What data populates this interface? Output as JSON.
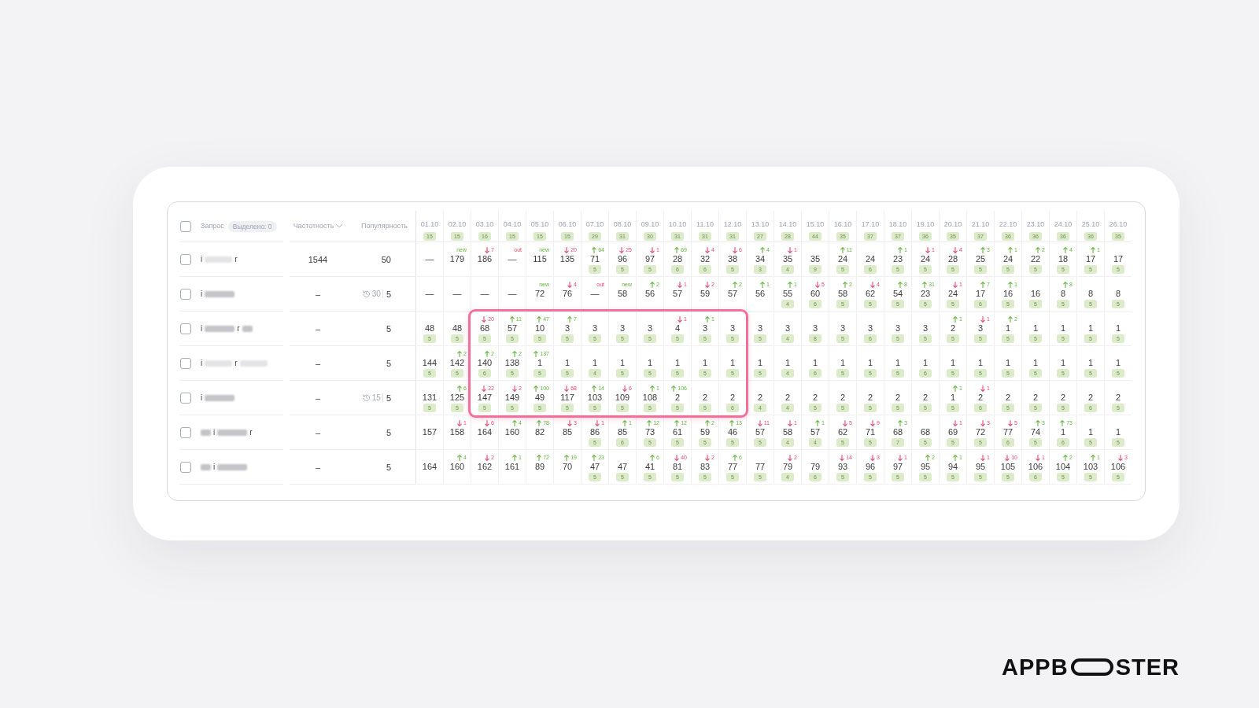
{
  "header": {
    "checked": false,
    "query_label": "Запрос",
    "selected_chip": "Выделено: 0",
    "frequency_label": "Частотность",
    "popularity_label": "Популярность"
  },
  "dates": [
    {
      "label": "01.10",
      "count": "15"
    },
    {
      "label": "02.10",
      "count": "15"
    },
    {
      "label": "03.10",
      "count": "16"
    },
    {
      "label": "04.10",
      "count": "15"
    },
    {
      "label": "05.10",
      "count": "15"
    },
    {
      "label": "06.10",
      "count": "15"
    },
    {
      "label": "07.10",
      "count": "29"
    },
    {
      "label": "08.10",
      "count": "31"
    },
    {
      "label": "09.10",
      "count": "30"
    },
    {
      "label": "10.10",
      "count": "31"
    },
    {
      "label": "11.10",
      "count": "31"
    },
    {
      "label": "12.10",
      "count": "31"
    },
    {
      "label": "13.10",
      "count": "27"
    },
    {
      "label": "14.10",
      "count": "28"
    },
    {
      "label": "15.10",
      "count": "44"
    },
    {
      "label": "16.10",
      "count": "35"
    },
    {
      "label": "17.10",
      "count": "37"
    },
    {
      "label": "18.10",
      "count": "37"
    },
    {
      "label": "19.10",
      "count": "36"
    },
    {
      "label": "20.10",
      "count": "35"
    },
    {
      "label": "21.10",
      "count": "37"
    },
    {
      "label": "22.10",
      "count": "36"
    },
    {
      "label": "23.10",
      "count": "36"
    },
    {
      "label": "24.10",
      "count": "36"
    },
    {
      "label": "25.10",
      "count": "36"
    },
    {
      "label": "26.10",
      "count": "35"
    }
  ],
  "rows": [
    {
      "checked": false,
      "query": [
        {
          "kind": "text",
          "text": "i"
        },
        {
          "kind": "faint_blur"
        },
        {
          "kind": "text",
          "text": "r"
        }
      ],
      "frequency": "1544",
      "popularity": "50",
      "cells": [
        {
          "kind": "same",
          "rank": "—"
        },
        {
          "kind": "new",
          "delta": "new",
          "rank": "179"
        },
        {
          "kind": "down",
          "delta": "7",
          "rank": "186"
        },
        {
          "kind": "out",
          "delta": "out",
          "rank": "—"
        },
        {
          "kind": "new",
          "delta": "new",
          "rank": "115"
        },
        {
          "kind": "down",
          "delta": "20",
          "rank": "135"
        },
        {
          "kind": "up",
          "delta": "64",
          "rank": "71",
          "badge": "5"
        },
        {
          "kind": "down",
          "delta": "25",
          "rank": "96",
          "badge": "5"
        },
        {
          "kind": "down",
          "delta": "1",
          "rank": "97",
          "badge": "5"
        },
        {
          "kind": "up",
          "delta": "69",
          "rank": "28",
          "badge": "6"
        },
        {
          "kind": "down",
          "delta": "4",
          "rank": "32",
          "badge": "6"
        },
        {
          "kind": "down",
          "delta": "6",
          "rank": "38",
          "badge": "5"
        },
        {
          "kind": "up",
          "delta": "4",
          "rank": "34",
          "badge": "3"
        },
        {
          "kind": "down",
          "delta": "1",
          "rank": "35",
          "badge": "4"
        },
        {
          "kind": "same",
          "rank": "35",
          "badge": "9"
        },
        {
          "kind": "up",
          "delta": "11",
          "rank": "24",
          "badge": "5"
        },
        {
          "kind": "same",
          "rank": "24",
          "badge": "6"
        },
        {
          "kind": "up",
          "delta": "1",
          "rank": "23",
          "badge": "5"
        },
        {
          "kind": "down",
          "delta": "1",
          "rank": "24",
          "badge": "5"
        },
        {
          "kind": "down",
          "delta": "4",
          "rank": "28",
          "badge": "5"
        },
        {
          "kind": "up",
          "delta": "3",
          "rank": "25",
          "badge": "5"
        },
        {
          "kind": "up",
          "delta": "1",
          "rank": "24",
          "badge": "5"
        },
        {
          "kind": "up",
          "delta": "2",
          "rank": "22",
          "badge": "5"
        },
        {
          "kind": "up",
          "delta": "4",
          "rank": "18",
          "badge": "5"
        },
        {
          "kind": "up",
          "delta": "1",
          "rank": "17",
          "badge": "5"
        },
        {
          "kind": "same",
          "rank": "17",
          "badge": "5"
        }
      ]
    },
    {
      "checked": false,
      "query": [
        {
          "kind": "text",
          "text": "i"
        },
        {
          "kind": "blur"
        }
      ],
      "frequency": "–",
      "history": "30",
      "popularity": "5",
      "cells": [
        {
          "kind": "same",
          "rank": "—"
        },
        {
          "kind": "same",
          "rank": "—"
        },
        {
          "kind": "same",
          "rank": "—"
        },
        {
          "kind": "same",
          "rank": "—"
        },
        {
          "kind": "new",
          "delta": "new",
          "rank": "72"
        },
        {
          "kind": "down",
          "delta": "4",
          "rank": "76"
        },
        {
          "kind": "out",
          "delta": "out",
          "rank": "—"
        },
        {
          "kind": "new",
          "delta": "new",
          "rank": "58"
        },
        {
          "kind": "up",
          "delta": "2",
          "rank": "56"
        },
        {
          "kind": "down",
          "delta": "1",
          "rank": "57"
        },
        {
          "kind": "down",
          "delta": "2",
          "rank": "59"
        },
        {
          "kind": "up",
          "delta": "2",
          "rank": "57"
        },
        {
          "kind": "up",
          "delta": "1",
          "rank": "56"
        },
        {
          "kind": "up",
          "delta": "1",
          "rank": "55",
          "badge": "4"
        },
        {
          "kind": "down",
          "delta": "5",
          "rank": "60",
          "badge": "6"
        },
        {
          "kind": "up",
          "delta": "2",
          "rank": "58",
          "badge": "5"
        },
        {
          "kind": "down",
          "delta": "4",
          "rank": "62",
          "badge": "5"
        },
        {
          "kind": "up",
          "delta": "8",
          "rank": "54",
          "badge": "5"
        },
        {
          "kind": "up",
          "delta": "31",
          "rank": "23",
          "badge": "5"
        },
        {
          "kind": "down",
          "delta": "1",
          "rank": "24",
          "badge": "5"
        },
        {
          "kind": "up",
          "delta": "7",
          "rank": "17",
          "badge": "6"
        },
        {
          "kind": "up",
          "delta": "1",
          "rank": "16",
          "badge": "5"
        },
        {
          "kind": "same",
          "rank": "16",
          "badge": "5"
        },
        {
          "kind": "up",
          "delta": "8",
          "rank": "8",
          "badge": "5"
        },
        {
          "kind": "same",
          "rank": "8",
          "badge": "5"
        },
        {
          "kind": "same",
          "rank": "8",
          "badge": "5"
        }
      ]
    },
    {
      "checked": false,
      "query": [
        {
          "kind": "text",
          "text": "i"
        },
        {
          "kind": "blur"
        },
        {
          "kind": "text",
          "text": "r"
        },
        {
          "kind": "short_blur"
        }
      ],
      "frequency": "–",
      "popularity": "5",
      "cells": [
        {
          "kind": "same",
          "rank": "48",
          "badge": "5"
        },
        {
          "kind": "same",
          "rank": "48",
          "badge": "5"
        },
        {
          "kind": "down",
          "delta": "20",
          "rank": "68",
          "badge": "5",
          "frame_start": true
        },
        {
          "kind": "up",
          "delta": "11",
          "rank": "57",
          "badge": "5"
        },
        {
          "kind": "up",
          "delta": "47",
          "rank": "10",
          "badge": "5"
        },
        {
          "kind": "up",
          "delta": "7",
          "rank": "3",
          "badge": "5"
        },
        {
          "kind": "same",
          "rank": "3",
          "badge": "5"
        },
        {
          "kind": "same",
          "rank": "3",
          "badge": "5"
        },
        {
          "kind": "same",
          "rank": "3",
          "badge": "5"
        },
        {
          "kind": "down",
          "delta": "1",
          "rank": "4",
          "badge": "5"
        },
        {
          "kind": "up",
          "delta": "1",
          "rank": "3",
          "badge": "5"
        },
        {
          "kind": "same",
          "rank": "3",
          "badge": "5"
        },
        {
          "kind": "same",
          "rank": "3",
          "badge": "5"
        },
        {
          "kind": "same",
          "rank": "3",
          "badge": "4"
        },
        {
          "kind": "same",
          "rank": "3",
          "badge": "8"
        },
        {
          "kind": "same",
          "rank": "3",
          "badge": "5"
        },
        {
          "kind": "same",
          "rank": "3",
          "badge": "6"
        },
        {
          "kind": "same",
          "rank": "3",
          "badge": "5"
        },
        {
          "kind": "same",
          "rank": "3",
          "badge": "5"
        },
        {
          "kind": "up",
          "delta": "1",
          "rank": "2",
          "badge": "5"
        },
        {
          "kind": "down",
          "delta": "1",
          "rank": "3",
          "badge": "5"
        },
        {
          "kind": "up",
          "delta": "2",
          "rank": "1",
          "badge": "5"
        },
        {
          "kind": "same",
          "rank": "1",
          "badge": "5"
        },
        {
          "kind": "same",
          "rank": "1",
          "badge": "5"
        },
        {
          "kind": "same",
          "rank": "1",
          "badge": "5"
        },
        {
          "kind": "same",
          "rank": "1",
          "badge": "5"
        }
      ]
    },
    {
      "checked": false,
      "query": [
        {
          "kind": "text",
          "text": "i"
        },
        {
          "kind": "faint_blur"
        },
        {
          "kind": "text",
          "text": "r"
        },
        {
          "kind": "faint_blur"
        }
      ],
      "frequency": "–",
      "popularity": "5",
      "cells": [
        {
          "kind": "same",
          "rank": "144",
          "badge": "5"
        },
        {
          "kind": "up",
          "delta": "2",
          "rank": "142",
          "badge": "5"
        },
        {
          "kind": "up",
          "delta": "2",
          "rank": "140",
          "badge": "6"
        },
        {
          "kind": "up",
          "delta": "2",
          "rank": "138",
          "badge": "5"
        },
        {
          "kind": "up",
          "delta": "137",
          "rank": "1",
          "badge": "5"
        },
        {
          "kind": "same",
          "rank": "1",
          "badge": "5"
        },
        {
          "kind": "same",
          "rank": "1",
          "badge": "4"
        },
        {
          "kind": "same",
          "rank": "1",
          "badge": "5"
        },
        {
          "kind": "same",
          "rank": "1",
          "badge": "5"
        },
        {
          "kind": "same",
          "rank": "1",
          "badge": "5"
        },
        {
          "kind": "same",
          "rank": "1",
          "badge": "5"
        },
        {
          "kind": "same",
          "rank": "1",
          "badge": "5"
        },
        {
          "kind": "same",
          "rank": "1",
          "badge": "5"
        },
        {
          "kind": "same",
          "rank": "1",
          "badge": "4"
        },
        {
          "kind": "same",
          "rank": "1",
          "badge": "6"
        },
        {
          "kind": "same",
          "rank": "1",
          "badge": "5"
        },
        {
          "kind": "same",
          "rank": "1",
          "badge": "5"
        },
        {
          "kind": "same",
          "rank": "1",
          "badge": "5"
        },
        {
          "kind": "same",
          "rank": "1",
          "badge": "6"
        },
        {
          "kind": "same",
          "rank": "1",
          "badge": "5"
        },
        {
          "kind": "same",
          "rank": "1",
          "badge": "5"
        },
        {
          "kind": "same",
          "rank": "1",
          "badge": "5"
        },
        {
          "kind": "same",
          "rank": "1",
          "badge": "5"
        },
        {
          "kind": "same",
          "rank": "1",
          "badge": "5"
        },
        {
          "kind": "same",
          "rank": "1",
          "badge": "5"
        },
        {
          "kind": "same",
          "rank": "1",
          "badge": "5"
        }
      ]
    },
    {
      "checked": false,
      "query": [
        {
          "kind": "text",
          "text": "i"
        },
        {
          "kind": "blur"
        }
      ],
      "frequency": "–",
      "history": "15",
      "popularity": "5",
      "cells": [
        {
          "kind": "same",
          "rank": "131",
          "badge": "5"
        },
        {
          "kind": "up",
          "delta": "6",
          "rank": "125",
          "badge": "5"
        },
        {
          "kind": "down",
          "delta": "22",
          "rank": "147",
          "badge": "5"
        },
        {
          "kind": "down",
          "delta": "2",
          "rank": "149",
          "badge": "5"
        },
        {
          "kind": "up",
          "delta": "100",
          "rank": "49",
          "badge": "5"
        },
        {
          "kind": "down",
          "delta": "68",
          "rank": "117",
          "badge": "5"
        },
        {
          "kind": "up",
          "delta": "14",
          "rank": "103",
          "badge": "5"
        },
        {
          "kind": "down",
          "delta": "6",
          "rank": "109",
          "badge": "5"
        },
        {
          "kind": "up",
          "delta": "1",
          "rank": "108",
          "badge": "5"
        },
        {
          "kind": "up",
          "delta": "106",
          "rank": "2",
          "badge": "5"
        },
        {
          "kind": "same",
          "rank": "2",
          "badge": "5"
        },
        {
          "kind": "same",
          "rank": "2",
          "badge": "6",
          "frame_end": true
        },
        {
          "kind": "same",
          "rank": "2",
          "badge": "4"
        },
        {
          "kind": "same",
          "rank": "2",
          "badge": "4"
        },
        {
          "kind": "same",
          "rank": "2",
          "badge": "5"
        },
        {
          "kind": "same",
          "rank": "2",
          "badge": "5"
        },
        {
          "kind": "same",
          "rank": "2",
          "badge": "5"
        },
        {
          "kind": "same",
          "rank": "2",
          "badge": "5"
        },
        {
          "kind": "same",
          "rank": "2",
          "badge": "5"
        },
        {
          "kind": "up",
          "delta": "1",
          "rank": "1",
          "badge": "5"
        },
        {
          "kind": "down",
          "delta": "1",
          "rank": "2",
          "badge": "6"
        },
        {
          "kind": "same",
          "rank": "2",
          "badge": "5"
        },
        {
          "kind": "same",
          "rank": "2",
          "badge": "5"
        },
        {
          "kind": "same",
          "rank": "2",
          "badge": "5"
        },
        {
          "kind": "same",
          "rank": "2",
          "badge": "6"
        },
        {
          "kind": "same",
          "rank": "2",
          "badge": "5"
        }
      ]
    },
    {
      "checked": false,
      "query": [
        {
          "kind": "short_blur"
        },
        {
          "kind": "text",
          "text": "i"
        },
        {
          "kind": "blur"
        },
        {
          "kind": "text",
          "text": "r"
        }
      ],
      "frequency": "–",
      "popularity": "5",
      "cells": [
        {
          "kind": "same",
          "rank": "157"
        },
        {
          "kind": "down",
          "delta": "1",
          "rank": "158"
        },
        {
          "kind": "down",
          "delta": "6",
          "rank": "164"
        },
        {
          "kind": "up",
          "delta": "4",
          "rank": "160"
        },
        {
          "kind": "up",
          "delta": "78",
          "rank": "82"
        },
        {
          "kind": "down",
          "delta": "3",
          "rank": "85"
        },
        {
          "kind": "down",
          "delta": "1",
          "rank": "86",
          "badge": "5"
        },
        {
          "kind": "up",
          "delta": "1",
          "rank": "85",
          "badge": "6"
        },
        {
          "kind": "up",
          "delta": "12",
          "rank": "73",
          "badge": "5"
        },
        {
          "kind": "up",
          "delta": "12",
          "rank": "61",
          "badge": "5"
        },
        {
          "kind": "up",
          "delta": "2",
          "rank": "59",
          "badge": "5"
        },
        {
          "kind": "up",
          "delta": "13",
          "rank": "46",
          "badge": "5"
        },
        {
          "kind": "down",
          "delta": "11",
          "rank": "57",
          "badge": "5"
        },
        {
          "kind": "down",
          "delta": "1",
          "rank": "58",
          "badge": "4"
        },
        {
          "kind": "up",
          "delta": "1",
          "rank": "57",
          "badge": "4"
        },
        {
          "kind": "down",
          "delta": "5",
          "rank": "62",
          "badge": "5"
        },
        {
          "kind": "down",
          "delta": "9",
          "rank": "71",
          "badge": "5"
        },
        {
          "kind": "up",
          "delta": "3",
          "rank": "68",
          "badge": "7"
        },
        {
          "kind": "same",
          "rank": "68",
          "badge": "5"
        },
        {
          "kind": "down",
          "delta": "1",
          "rank": "69",
          "badge": "5"
        },
        {
          "kind": "down",
          "delta": "3",
          "rank": "72",
          "badge": "5"
        },
        {
          "kind": "down",
          "delta": "5",
          "rank": "77",
          "badge": "6"
        },
        {
          "kind": "up",
          "delta": "3",
          "rank": "74",
          "badge": "5"
        },
        {
          "kind": "up",
          "delta": "73",
          "rank": "1",
          "badge": "6"
        },
        {
          "kind": "same",
          "rank": "1",
          "badge": "5"
        },
        {
          "kind": "same",
          "rank": "1",
          "badge": "5"
        }
      ]
    },
    {
      "checked": false,
      "query": [
        {
          "kind": "short_blur"
        },
        {
          "kind": "text",
          "text": "i"
        },
        {
          "kind": "blur"
        }
      ],
      "frequency": "–",
      "popularity": "5",
      "cells": [
        {
          "kind": "same",
          "rank": "164"
        },
        {
          "kind": "up",
          "delta": "4",
          "rank": "160"
        },
        {
          "kind": "down",
          "delta": "2",
          "rank": "162"
        },
        {
          "kind": "up",
          "delta": "1",
          "rank": "161"
        },
        {
          "kind": "up",
          "delta": "72",
          "rank": "89"
        },
        {
          "kind": "up",
          "delta": "19",
          "rank": "70"
        },
        {
          "kind": "up",
          "delta": "23",
          "rank": "47",
          "badge": "5"
        },
        {
          "kind": "same",
          "rank": "47",
          "badge": "5"
        },
        {
          "kind": "up",
          "delta": "6",
          "rank": "41",
          "badge": "5"
        },
        {
          "kind": "down",
          "delta": "40",
          "rank": "81",
          "badge": "5"
        },
        {
          "kind": "down",
          "delta": "2",
          "rank": "83",
          "badge": "5"
        },
        {
          "kind": "up",
          "delta": "6",
          "rank": "77",
          "badge": "5"
        },
        {
          "kind": "same",
          "rank": "77",
          "badge": "5"
        },
        {
          "kind": "down",
          "delta": "2",
          "rank": "79",
          "badge": "4"
        },
        {
          "kind": "same",
          "rank": "79",
          "badge": "6"
        },
        {
          "kind": "down",
          "delta": "14",
          "rank": "93",
          "badge": "5"
        },
        {
          "kind": "down",
          "delta": "3",
          "rank": "96",
          "badge": "5"
        },
        {
          "kind": "down",
          "delta": "1",
          "rank": "97",
          "badge": "5"
        },
        {
          "kind": "up",
          "delta": "2",
          "rank": "95",
          "badge": "5"
        },
        {
          "kind": "up",
          "delta": "1",
          "rank": "94",
          "badge": "5"
        },
        {
          "kind": "down",
          "delta": "1",
          "rank": "95",
          "badge": "5"
        },
        {
          "kind": "down",
          "delta": "10",
          "rank": "105",
          "badge": "5"
        },
        {
          "kind": "down",
          "delta": "1",
          "rank": "106",
          "badge": "6"
        },
        {
          "kind": "up",
          "delta": "2",
          "rank": "104",
          "badge": "5"
        },
        {
          "kind": "up",
          "delta": "1",
          "rank": "103",
          "badge": "5"
        },
        {
          "kind": "down",
          "delta": "3",
          "rank": "106",
          "badge": "5"
        }
      ]
    }
  ],
  "logo": {
    "left": "APPB",
    "right": "STER"
  }
}
